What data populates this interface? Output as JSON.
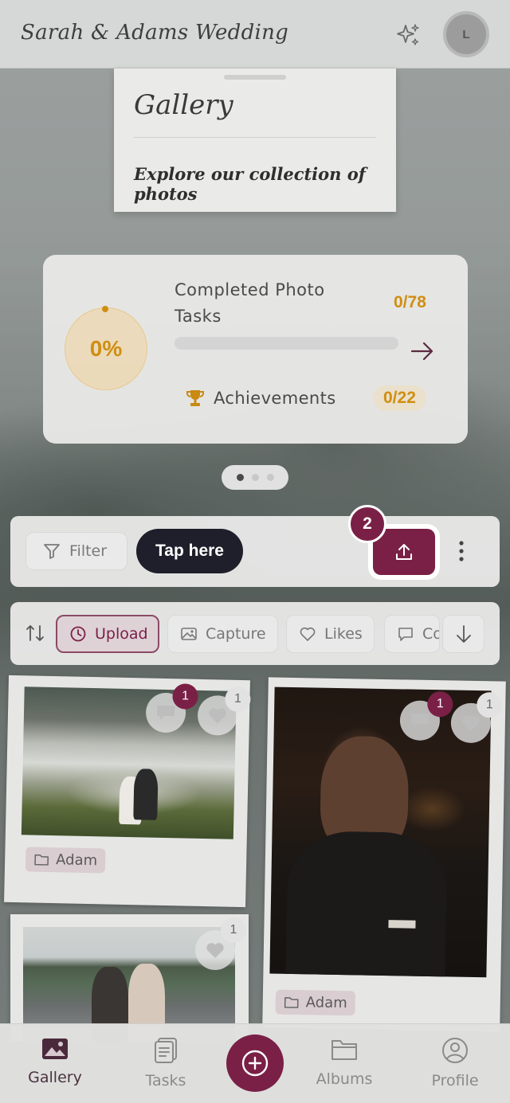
{
  "header": {
    "title": "Sarah & Adams Wedding",
    "avatar_initial": "L",
    "sparkle_icon": "sparkle-icon"
  },
  "gallery": {
    "title": "Gallery",
    "subtitle": "Explore our collection of photos"
  },
  "progress": {
    "percent_label": "0%",
    "percent_value": 0,
    "tasks_label": "Completed Photo Tasks",
    "tasks_count": "0/78",
    "achievements_label": "Achievements",
    "achievements_count": "0/22",
    "pager_active_index": 0,
    "pager_count": 3
  },
  "toolbar": {
    "filter_label": "Filter",
    "tooltip_label": "Tap here",
    "step_number": "2",
    "upload_icon": "upload-icon",
    "more_icon": "more-vertical-icon"
  },
  "sort_chips": [
    {
      "label": "Upload",
      "icon": "clock-icon",
      "active": true
    },
    {
      "label": "Capture",
      "icon": "image-icon",
      "active": false
    },
    {
      "label": "Likes",
      "icon": "heart-icon",
      "active": false
    },
    {
      "label": "Comments",
      "icon": "comment-icon",
      "active": false
    }
  ],
  "photos": [
    {
      "album": "Adam",
      "comments": "1",
      "likes": "1"
    },
    {
      "album": "Adam",
      "comments": "1",
      "likes": "1"
    },
    {
      "likes": "1"
    }
  ],
  "bottom_nav": [
    {
      "label": "Gallery",
      "icon": "gallery-icon",
      "active": true
    },
    {
      "label": "Tasks",
      "icon": "tasks-icon",
      "active": false
    },
    {
      "label": "Albums",
      "icon": "folder-icon",
      "active": false
    },
    {
      "label": "Profile",
      "icon": "profile-icon",
      "active": false
    }
  ],
  "colors": {
    "accent": "#7a2046",
    "progress_orange": "#d08e10",
    "tooltip_bg": "#1f1f2b"
  }
}
